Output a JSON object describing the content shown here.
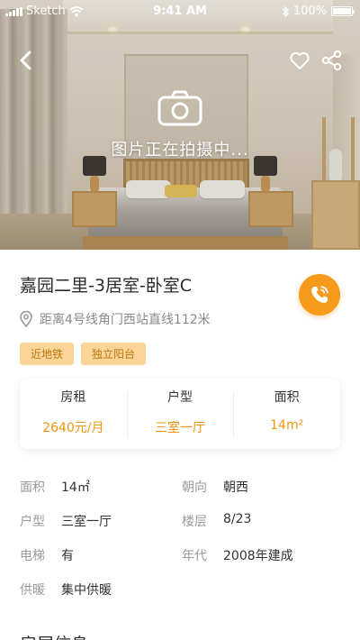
{
  "status_bar": {
    "carrier": "Sketch",
    "time": "9:41 AM",
    "battery": "100%"
  },
  "hero": {
    "overlay_text": "图片正在拍摄中...",
    "icons": [
      "back-arrow-icon",
      "heart-icon",
      "share-icon",
      "camera-icon"
    ]
  },
  "listing": {
    "title": "嘉园二里-3居室-卧室C",
    "location": "距离4号线角门西站直线112米",
    "tags": [
      "近地铁",
      "独立阳台"
    ]
  },
  "summary": [
    {
      "label": "房租",
      "value": "2640元/月"
    },
    {
      "label": "户型",
      "value": "三室一厅"
    },
    {
      "label": "面积",
      "value": "14m²"
    }
  ],
  "details": [
    {
      "label": "面积",
      "value": "14㎡"
    },
    {
      "label": "朝向",
      "value": "朝西"
    },
    {
      "label": "户型",
      "value": "三室一厅"
    },
    {
      "label": "楼层",
      "value": "8/23"
    },
    {
      "label": "电梯",
      "value": "有"
    },
    {
      "label": "年代",
      "value": "2008年建成"
    },
    {
      "label": "供暖",
      "value": "集中供暖"
    }
  ],
  "section_title": "房屋信息",
  "colors": {
    "accent": "#f79a1c",
    "tag_bg": "#fbd597",
    "tag_text": "#b97710"
  }
}
